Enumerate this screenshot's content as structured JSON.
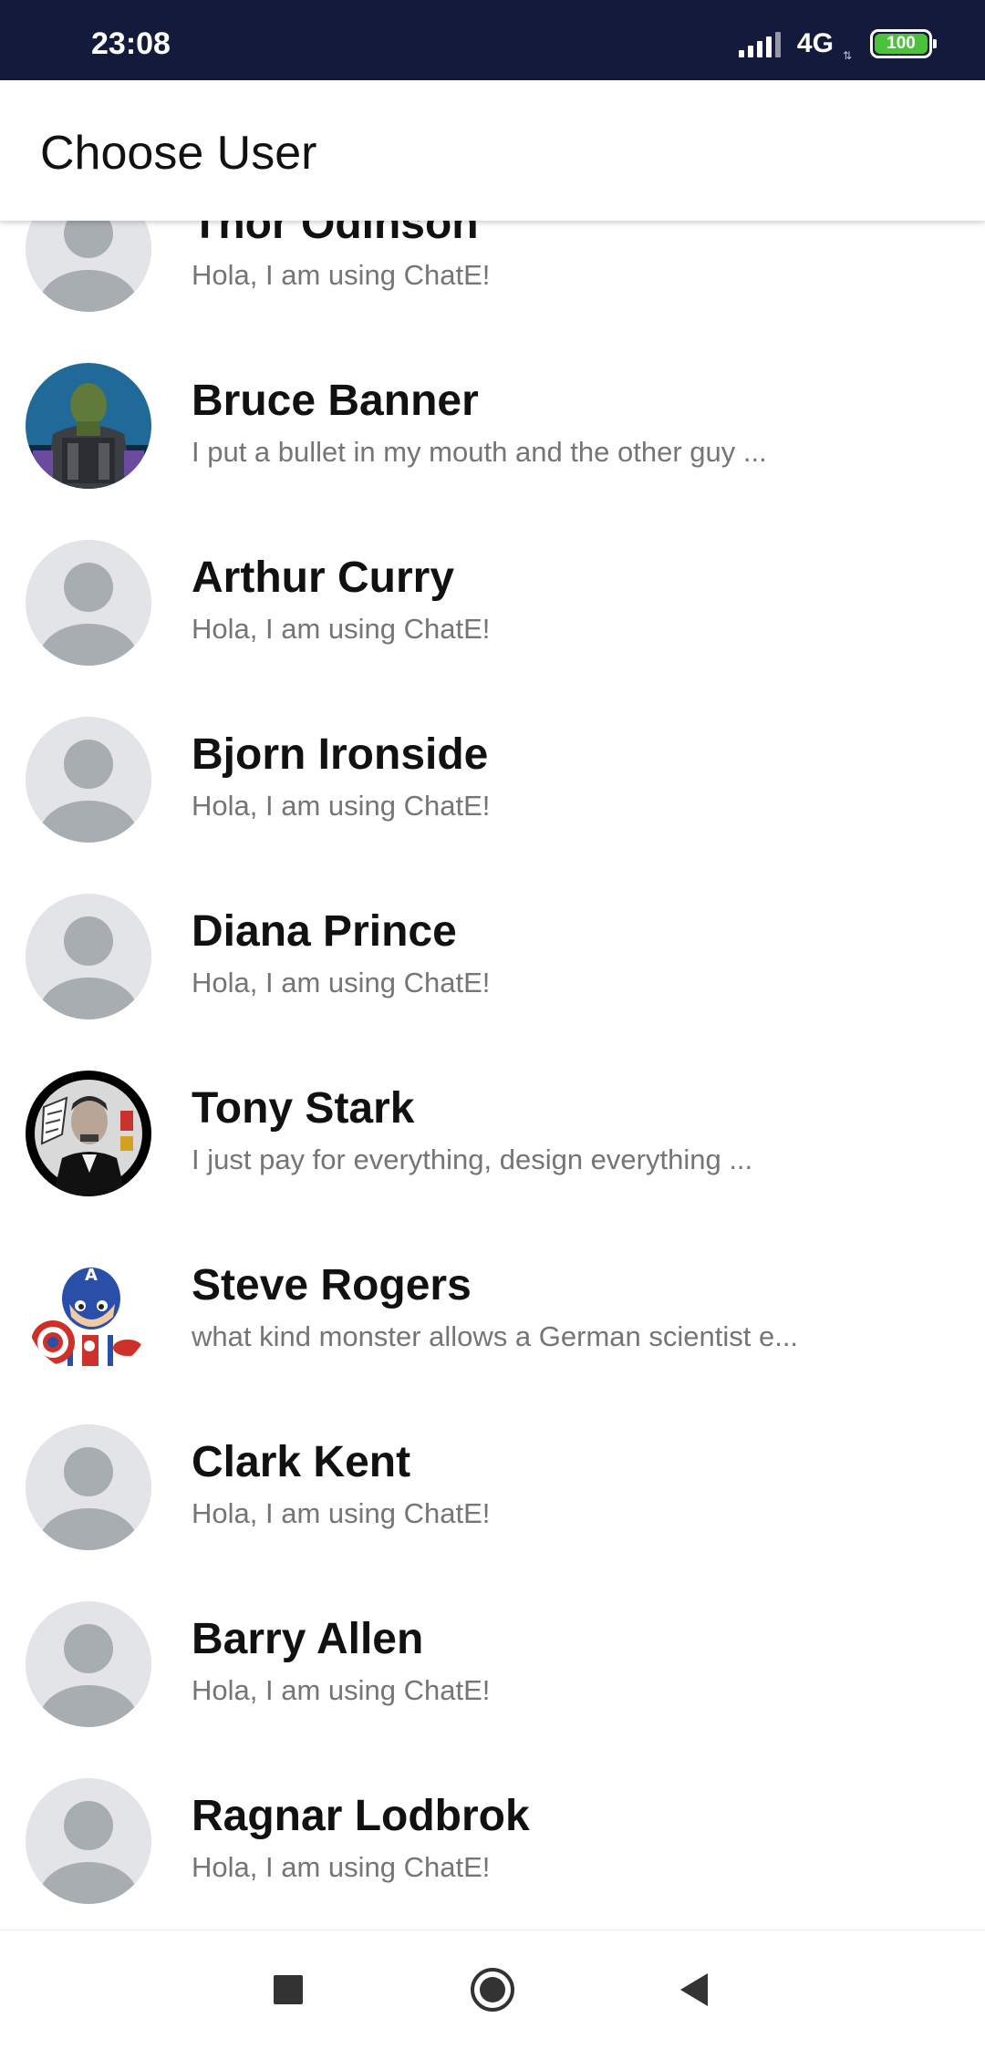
{
  "status_bar": {
    "time": "23:08",
    "network": "4G",
    "battery": "100",
    "icons": [
      "signal-icon",
      "battery-icon"
    ],
    "battery_color": "#4cc23a"
  },
  "app_bar": {
    "title": "Choose User"
  },
  "users": [
    {
      "name": "Thor Odinson",
      "status": "Hola, I am using ChatE!",
      "avatar": "default-avatar-icon"
    },
    {
      "name": "Bruce Banner",
      "status": "I put a bullet in my mouth and the other guy ...",
      "avatar": "hulk-avatar"
    },
    {
      "name": "Arthur Curry",
      "status": "Hola, I am using ChatE!",
      "avatar": "default-avatar-icon"
    },
    {
      "name": "Bjorn Ironside",
      "status": "Hola, I am using ChatE!",
      "avatar": "default-avatar-icon"
    },
    {
      "name": "Diana Prince",
      "status": "Hola, I am using ChatE!",
      "avatar": "default-avatar-icon"
    },
    {
      "name": "Tony Stark",
      "status": "I just pay for everything, design everything ...",
      "avatar": "tony-stark-avatar"
    },
    {
      "name": "Steve Rogers",
      "status": "what kind monster allows a German scientist e...",
      "avatar": "captain-america-avatar"
    },
    {
      "name": "Clark Kent",
      "status": "Hola, I am using ChatE!",
      "avatar": "default-avatar-icon"
    },
    {
      "name": "Barry Allen",
      "status": "Hola, I am using ChatE!",
      "avatar": "default-avatar-icon"
    },
    {
      "name": "Ragnar Lodbrok",
      "status": "Hola, I am using ChatE!",
      "avatar": "default-avatar-icon"
    }
  ],
  "nav_bar": {
    "buttons": [
      "recents-square-icon",
      "home-circle-icon",
      "back-triangle-icon"
    ]
  },
  "colors": {
    "status_bar_bg": "#141a3c",
    "name_text": "#111111",
    "status_text": "#757575",
    "avatar_bg": "#e2e4e7",
    "avatar_figure": "#a8adb2"
  }
}
